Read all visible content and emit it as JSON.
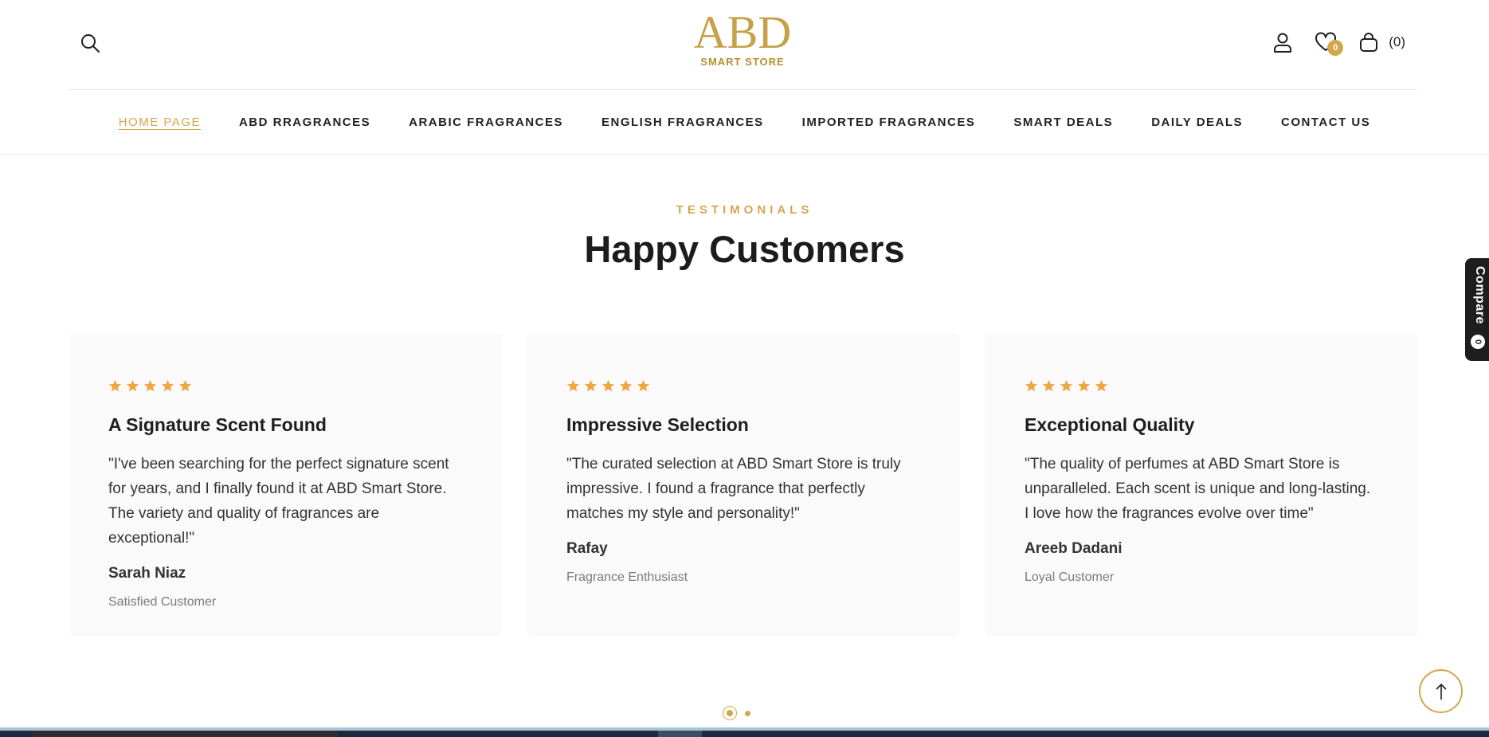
{
  "header": {
    "logo_text": "ABD",
    "logo_subtitle": "SMART STORE",
    "wishlist_count": "0",
    "cart_count": "(0)"
  },
  "icons": {
    "search": "search-icon",
    "account": "user-icon",
    "wishlist": "heart-icon",
    "cart": "shopping-bag-icon",
    "scroll_top": "arrow-up-icon",
    "star": "star-icon"
  },
  "nav": {
    "items": [
      {
        "label": "HOME PAGE",
        "active": true
      },
      {
        "label": "ABD RRAGRANCES",
        "active": false
      },
      {
        "label": "ARABIC FRAGRANCES",
        "active": false
      },
      {
        "label": "ENGLISH FRAGRANCES",
        "active": false
      },
      {
        "label": "IMPORTED FRAGRANCES",
        "active": false
      },
      {
        "label": "SMART DEALS",
        "active": false
      },
      {
        "label": "DAILY DEALS",
        "active": false
      },
      {
        "label": "CONTACT US",
        "active": false
      }
    ]
  },
  "section": {
    "eyebrow": "TESTIMONIALS",
    "title": "Happy Customers"
  },
  "testimonials": [
    {
      "rating": 5,
      "title": "A Signature Scent Found",
      "quote": "\"I've been searching for the perfect signature scent for years, and I finally found it at ABD Smart Store. The variety and quality of fragrances are exceptional!\"",
      "name": "Sarah Niaz",
      "role": "Satisfied Customer"
    },
    {
      "rating": 5,
      "title": "Impressive Selection",
      "quote": "\"The curated selection at ABD Smart Store is truly impressive. I found a fragrance that perfectly matches my style and personality!\"",
      "name": "Rafay",
      "role": "Fragrance Enthusiast"
    },
    {
      "rating": 5,
      "title": "Exceptional Quality",
      "quote": "\"The quality of perfumes at ABD Smart Store is unparalleled. Each scent is unique and long-lasting. I love how the fragrances evolve over time\"",
      "name": "Areeb Dadani",
      "role": "Loyal Customer"
    }
  ],
  "compare": {
    "label": "Compare",
    "count": "0"
  },
  "pagination": {
    "pages": 2,
    "current": 1
  },
  "colors": {
    "accent": "#d4a64e",
    "star": "#f0a640",
    "text": "#1e1e1e",
    "card_bg": "#fafafa"
  }
}
